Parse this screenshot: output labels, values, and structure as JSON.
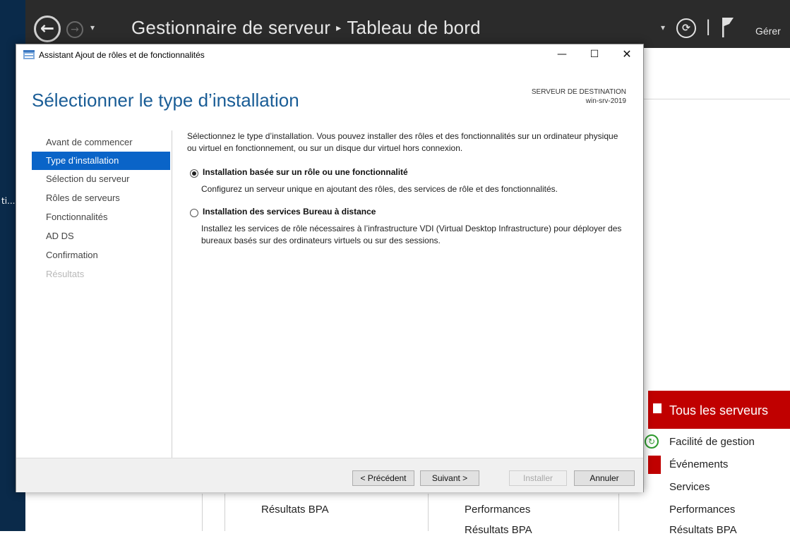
{
  "desktop": {
    "truncated_label": "ti..."
  },
  "server_manager": {
    "title": "Gestionnaire de serveur",
    "title_separator": "▸",
    "breadcrumb_current": "Tableau de bord",
    "manage_menu": "Gérer",
    "back_icon": "←",
    "forward_icon": "→",
    "dropdown_icon": "▾",
    "refresh_icon": "⟳",
    "pipe": "|",
    "tile": {
      "title": "Tous les serveurs",
      "items": [
        "Facilité de gestion",
        "Événements",
        "Services",
        "Performances",
        "Résultats BPA"
      ],
      "manageability_icon": "↻"
    },
    "other_tiles": {
      "col1_bpa": "Résultats BPA",
      "col2_perf": "Performances",
      "col2_bpa": "Résultats BPA"
    },
    "colors": {
      "header_bg": "#2b2b2b",
      "alert_red": "#c00000",
      "ok_green": "#2e9b2e"
    }
  },
  "dialog": {
    "title": "Assistant Ajout de rôles et de fonctionnalités",
    "window_controls": {
      "minimize": "—",
      "maximize": "☐",
      "close": "✕"
    },
    "heading": "Sélectionner le type d’installation",
    "destination": {
      "label": "SERVEUR DE DESTINATION",
      "value": "win-srv-2019"
    },
    "nav": [
      {
        "label": "Avant de commencer",
        "state": "normal"
      },
      {
        "label": "Type d’installation",
        "state": "active"
      },
      {
        "label": "Sélection du serveur",
        "state": "normal"
      },
      {
        "label": "Rôles de serveurs",
        "state": "normal"
      },
      {
        "label": "Fonctionnalités",
        "state": "normal"
      },
      {
        "label": "AD DS",
        "state": "normal"
      },
      {
        "label": "Confirmation",
        "state": "normal"
      },
      {
        "label": "Résultats",
        "state": "disabled"
      }
    ],
    "intro": "Sélectionnez le type d’installation. Vous pouvez installer des rôles et des fonctionnalités sur un ordinateur physique ou virtuel en fonctionnement, ou sur un disque dur virtuel hors connexion.",
    "options": [
      {
        "label": "Installation basée sur un rôle ou une fonctionnalité",
        "description": "Configurez un serveur unique en ajoutant des rôles, des services de rôle et des fonctionnalités.",
        "selected": true
      },
      {
        "label": "Installation des services Bureau à distance",
        "description": "Installez les services de rôle nécessaires à l’infrastructure VDI (Virtual Desktop Infrastructure) pour déployer des bureaux basés sur des ordinateurs virtuels ou sur des sessions.",
        "selected": false
      }
    ],
    "buttons": {
      "previous": "< Précédent",
      "next": "Suivant >",
      "install": "Installer",
      "cancel": "Annuler"
    },
    "colors": {
      "heading": "#1a5d96",
      "nav_active_bg": "#0a64c8"
    }
  }
}
